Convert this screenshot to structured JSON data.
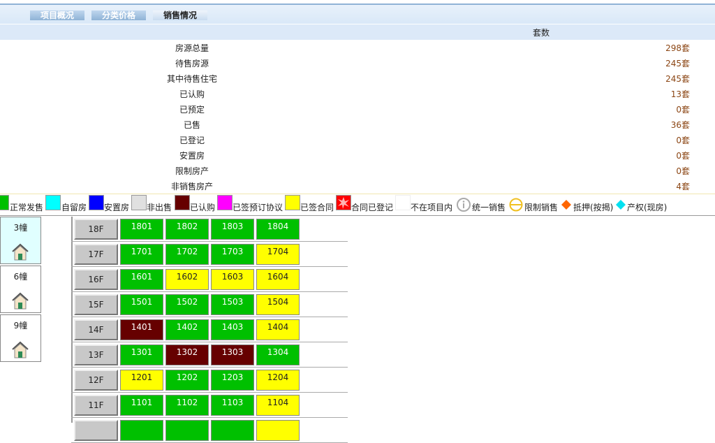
{
  "tabs": [
    {
      "label": "项目概况",
      "active": false
    },
    {
      "label": "分类价格",
      "active": false
    },
    {
      "label": "销售情况",
      "active": true
    }
  ],
  "summary": {
    "column_header": "套数",
    "rows": [
      {
        "label": "房源总量",
        "value": "298套"
      },
      {
        "label": "待售房源",
        "value": "245套"
      },
      {
        "label": "其中待售住宅",
        "value": "245套"
      },
      {
        "label": "已认购",
        "value": "13套"
      },
      {
        "label": "已预定",
        "value": "0套"
      },
      {
        "label": "已售",
        "value": "36套"
      },
      {
        "label": "已登记",
        "value": "0套"
      },
      {
        "label": "安置房",
        "value": "0套"
      },
      {
        "label": "限制房产",
        "value": "0套"
      },
      {
        "label": "非销售房产",
        "value": "4套"
      }
    ]
  },
  "legend": [
    {
      "label": "正常发售",
      "color": "#00c000"
    },
    {
      "label": "自留房",
      "color": "#00ffff"
    },
    {
      "label": "安置房",
      "color": "#0000ff"
    },
    {
      "label": "非出售",
      "color": "#e0e0e0"
    },
    {
      "label": "已认购",
      "color": "#660000"
    },
    {
      "label": "已签预订协议",
      "color": "#ff00ff"
    },
    {
      "label": "已签合同",
      "color": "#ffff00"
    },
    {
      "label": "合同已登记",
      "color": "#ff0000"
    },
    {
      "label": "不在项目内",
      "color": "#ffffff"
    },
    {
      "label": "统一销售",
      "icon": "info-circle-icon"
    },
    {
      "label": "限制销售",
      "icon": "restricted-circle-icon"
    },
    {
      "label": "抵押(按揭)",
      "icon": "orange-diamond-icon"
    },
    {
      "label": "产权(现房)",
      "icon": "cyan-diamond-icon"
    }
  ],
  "buildings": [
    {
      "label": "3幢",
      "active": true
    },
    {
      "label": "6幢",
      "active": false
    },
    {
      "label": "9幢",
      "active": false
    }
  ],
  "colors": {
    "green": "#00c000",
    "yellow": "#ffff00",
    "maroon": "#660000"
  },
  "floors": [
    {
      "floor": "18F",
      "units": [
        {
          "no": "1801",
          "status": "green"
        },
        {
          "no": "1802",
          "status": "green"
        },
        {
          "no": "1803",
          "status": "green"
        },
        {
          "no": "1804",
          "status": "green"
        }
      ]
    },
    {
      "floor": "17F",
      "units": [
        {
          "no": "1701",
          "status": "green"
        },
        {
          "no": "1702",
          "status": "green"
        },
        {
          "no": "1703",
          "status": "green"
        },
        {
          "no": "1704",
          "status": "yellow"
        }
      ]
    },
    {
      "floor": "16F",
      "units": [
        {
          "no": "1601",
          "status": "green"
        },
        {
          "no": "1602",
          "status": "yellow"
        },
        {
          "no": "1603",
          "status": "yellow"
        },
        {
          "no": "1604",
          "status": "yellow"
        }
      ]
    },
    {
      "floor": "15F",
      "units": [
        {
          "no": "1501",
          "status": "green"
        },
        {
          "no": "1502",
          "status": "green"
        },
        {
          "no": "1503",
          "status": "green"
        },
        {
          "no": "1504",
          "status": "yellow"
        }
      ]
    },
    {
      "floor": "14F",
      "units": [
        {
          "no": "1401",
          "status": "maroon"
        },
        {
          "no": "1402",
          "status": "green"
        },
        {
          "no": "1403",
          "status": "green"
        },
        {
          "no": "1404",
          "status": "yellow"
        }
      ]
    },
    {
      "floor": "13F",
      "units": [
        {
          "no": "1301",
          "status": "green"
        },
        {
          "no": "1302",
          "status": "maroon"
        },
        {
          "no": "1303",
          "status": "maroon"
        },
        {
          "no": "1304",
          "status": "green"
        }
      ]
    },
    {
      "floor": "12F",
      "units": [
        {
          "no": "1201",
          "status": "yellow"
        },
        {
          "no": "1202",
          "status": "green"
        },
        {
          "no": "1203",
          "status": "green"
        },
        {
          "no": "1204",
          "status": "yellow"
        }
      ]
    },
    {
      "floor": "11F",
      "units": [
        {
          "no": "1101",
          "status": "green"
        },
        {
          "no": "1102",
          "status": "green"
        },
        {
          "no": "1103",
          "status": "green"
        },
        {
          "no": "1104",
          "status": "yellow"
        }
      ]
    },
    {
      "floor": "",
      "units": [
        {
          "no": "",
          "status": "green"
        },
        {
          "no": "",
          "status": "green"
        },
        {
          "no": "",
          "status": "green"
        },
        {
          "no": "",
          "status": "yellow"
        }
      ]
    }
  ]
}
